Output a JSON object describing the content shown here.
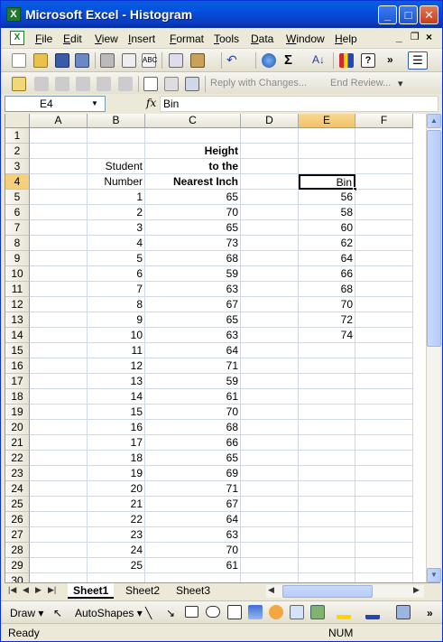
{
  "window": {
    "title": "Microsoft Excel - Histogram",
    "app_icon": "excel-icon"
  },
  "menu": {
    "items": [
      "File",
      "Edit",
      "View",
      "Insert",
      "Format",
      "Tools",
      "Data",
      "Window",
      "Help"
    ],
    "controls": [
      "_",
      "×"
    ]
  },
  "reviewing": {
    "reply": "Reply with Changes...",
    "end_review": "End Review..."
  },
  "formula": {
    "namebox": "E4",
    "fx": "fx",
    "content": "Bin"
  },
  "grid": {
    "columns": [
      "A",
      "B",
      "C",
      "D",
      "E",
      "F"
    ],
    "active_column": "E",
    "active_row": 4,
    "rows": [
      1,
      2,
      3,
      4,
      5,
      6,
      7,
      8,
      9,
      10,
      11,
      12,
      13,
      14,
      15,
      16,
      17,
      18,
      19,
      20,
      21,
      22,
      23,
      24,
      25,
      26,
      27,
      28,
      29,
      30
    ],
    "headers": {
      "c2": "Height",
      "b3": "Student",
      "c3": "to the",
      "b4": "Number",
      "c4": "Nearest Inch",
      "e4": "Bin"
    },
    "students": [
      [
        1,
        65
      ],
      [
        2,
        70
      ],
      [
        3,
        65
      ],
      [
        4,
        73
      ],
      [
        5,
        68
      ],
      [
        6,
        59
      ],
      [
        7,
        63
      ],
      [
        8,
        67
      ],
      [
        9,
        65
      ],
      [
        10,
        63
      ],
      [
        11,
        64
      ],
      [
        12,
        71
      ],
      [
        13,
        59
      ],
      [
        14,
        61
      ],
      [
        15,
        70
      ],
      [
        16,
        68
      ],
      [
        17,
        66
      ],
      [
        18,
        65
      ],
      [
        19,
        69
      ],
      [
        20,
        71
      ],
      [
        21,
        67
      ],
      [
        22,
        64
      ],
      [
        23,
        63
      ],
      [
        24,
        70
      ],
      [
        25,
        61
      ]
    ],
    "bins": [
      56,
      58,
      60,
      62,
      64,
      66,
      68,
      70,
      72,
      74
    ]
  },
  "sheets": {
    "tabs": [
      "Sheet1",
      "Sheet2",
      "Sheet3"
    ],
    "active": "Sheet1"
  },
  "draw": {
    "draw_label": "Draw ▾",
    "autoshapes_label": "AutoShapes ▾"
  },
  "status": {
    "left": "Ready",
    "num": "NUM"
  },
  "colors": {
    "title_blue": "#0453e1",
    "selection_header": "#f6cf7a",
    "excel_green": "#1f7a2e"
  }
}
